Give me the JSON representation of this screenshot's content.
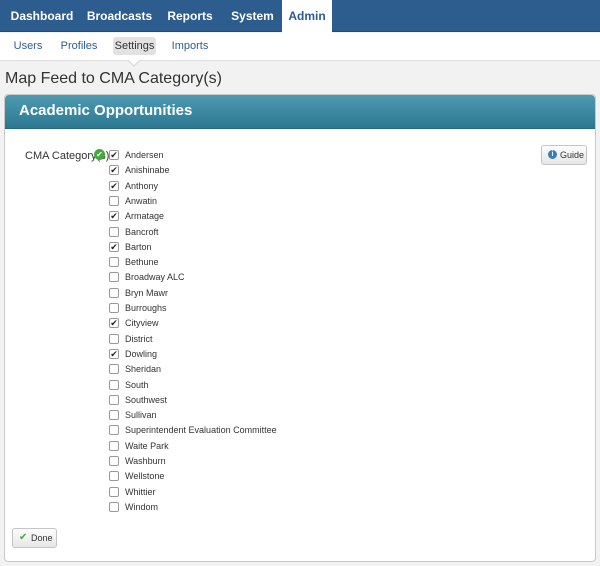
{
  "nav": {
    "items": [
      {
        "label": "Dashboard",
        "active": false
      },
      {
        "label": "Broadcasts",
        "active": false
      },
      {
        "label": "Reports",
        "active": false
      },
      {
        "label": "System",
        "active": false
      },
      {
        "label": "Admin",
        "active": true
      }
    ]
  },
  "subnav": {
    "items": [
      {
        "label": "Users",
        "active": false
      },
      {
        "label": "Profiles",
        "active": false
      },
      {
        "label": "Settings",
        "active": true
      },
      {
        "label": "Imports",
        "active": false
      }
    ]
  },
  "page": {
    "title": "Map Feed to CMA Category(s)"
  },
  "panel": {
    "title": "Academic Opportunities",
    "field_label": "CMA Category(s)",
    "guide_label": "Guide",
    "done_label": "Done",
    "categories": [
      {
        "label": "Andersen",
        "checked": true
      },
      {
        "label": "Anishinabe",
        "checked": true
      },
      {
        "label": "Anthony",
        "checked": true
      },
      {
        "label": "Anwatin",
        "checked": false
      },
      {
        "label": "Armatage",
        "checked": true
      },
      {
        "label": "Bancroft",
        "checked": false
      },
      {
        "label": "Barton",
        "checked": true
      },
      {
        "label": "Bethune",
        "checked": false
      },
      {
        "label": "Broadway ALC",
        "checked": false
      },
      {
        "label": "Bryn Mawr",
        "checked": false
      },
      {
        "label": "Burroughs",
        "checked": false
      },
      {
        "label": "Cityview",
        "checked": true
      },
      {
        "label": "District",
        "checked": false
      },
      {
        "label": "Dowling",
        "checked": true
      },
      {
        "label": "Sheridan",
        "checked": false
      },
      {
        "label": "South",
        "checked": false
      },
      {
        "label": "Southwest",
        "checked": false
      },
      {
        "label": "Sullivan",
        "checked": false
      },
      {
        "label": "Superintendent Evaluation Committee",
        "checked": false
      },
      {
        "label": "Waite Park",
        "checked": false
      },
      {
        "label": "Washburn",
        "checked": false
      },
      {
        "label": "Wellstone",
        "checked": false
      },
      {
        "label": "Whittier",
        "checked": false
      },
      {
        "label": "Windom",
        "checked": false
      }
    ]
  }
}
